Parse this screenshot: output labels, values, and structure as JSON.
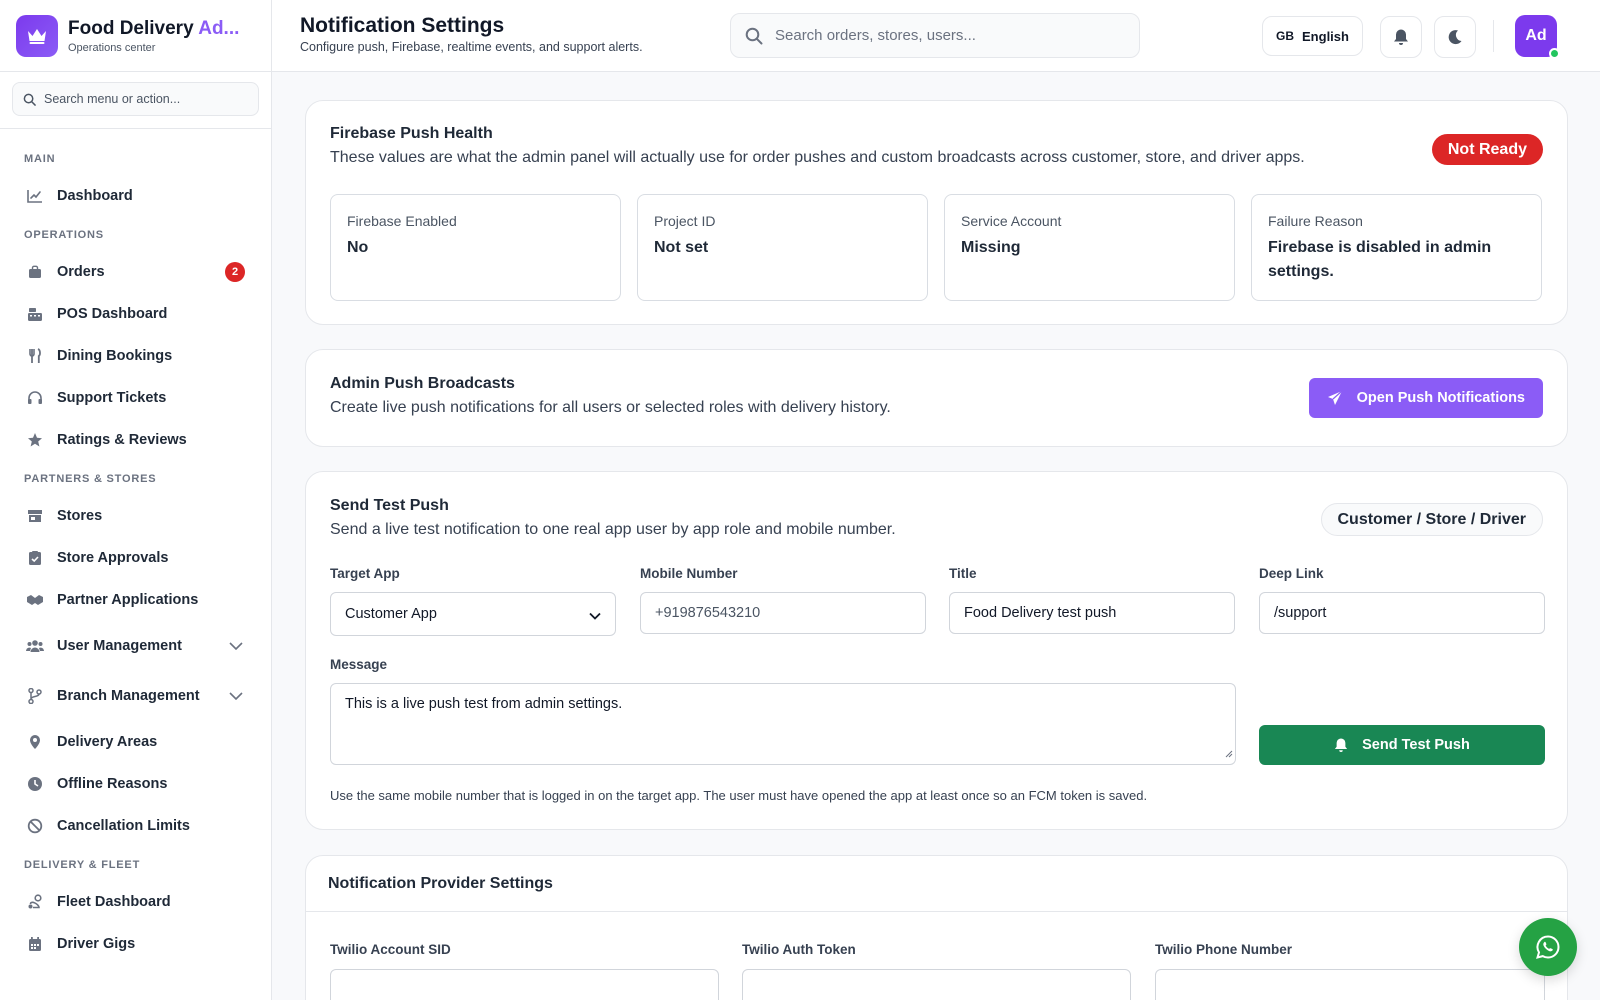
{
  "brand": {
    "title_main": "Food Delivery ",
    "title_accent": "Ad...",
    "subtitle": "Operations center"
  },
  "sidebar": {
    "search_placeholder": "Search menu or action...",
    "sections": {
      "main": "MAIN",
      "operations": "OPERATIONS",
      "partners": "PARTNERS & STORES",
      "fleet": "DELIVERY & FLEET"
    },
    "items": {
      "dashboard": "Dashboard",
      "orders": "Orders",
      "orders_badge": "2",
      "pos": "POS Dashboard",
      "dining": "Dining Bookings",
      "support": "Support Tickets",
      "ratings": "Ratings & Reviews",
      "stores": "Stores",
      "store_approvals": "Store Approvals",
      "partner_apps": "Partner Applications",
      "user_mgmt": "User Management",
      "branch_mgmt": "Branch Management",
      "delivery_areas": "Delivery Areas",
      "offline_reasons": "Offline Reasons",
      "cancellation": "Cancellation Limits",
      "fleet_dashboard": "Fleet Dashboard",
      "driver_gigs": "Driver Gigs"
    }
  },
  "header": {
    "title": "Notification Settings",
    "subtitle": "Configure push, Firebase, realtime events, and support alerts.",
    "search_placeholder": "Search orders, stores, users...",
    "lang_code": "GB",
    "lang_label": "English",
    "avatar": "Ad"
  },
  "firebase": {
    "title": "Firebase Push Health",
    "desc": "These values are what the admin panel will actually use for order pushes and custom broadcasts across customer, store, and driver apps.",
    "status": "Not Ready",
    "status_color": "#dc2626",
    "stats": [
      {
        "label": "Firebase Enabled",
        "value": "No"
      },
      {
        "label": "Project ID",
        "value": "Not set"
      },
      {
        "label": "Service Account",
        "value": "Missing"
      },
      {
        "label": "Failure Reason",
        "value": "Firebase is disabled in admin settings."
      }
    ]
  },
  "broadcasts": {
    "title": "Admin Push Broadcasts",
    "desc": "Create live push notifications for all users or selected roles with delivery history.",
    "button": "Open Push Notifications"
  },
  "test_push": {
    "title": "Send Test Push",
    "desc": "Send a live test notification to one real app user by app role and mobile number.",
    "roles": "Customer / Store / Driver",
    "target_label": "Target App",
    "target_value": "Customer App",
    "mobile_label": "Mobile Number",
    "mobile_placeholder": "+919876543210",
    "title_label": "Title",
    "title_value": "Food Delivery test push",
    "link_label": "Deep Link",
    "link_value": "/support",
    "message_label": "Message",
    "message_value": "This is a live push test from admin settings.",
    "send_button": "Send Test Push",
    "help": "Use the same mobile number that is logged in on the target app. The user must have opened the app at least once so an FCM token is saved."
  },
  "provider": {
    "title": "Notification Provider Settings",
    "sid_label": "Twilio Account SID",
    "token_label": "Twilio Auth Token",
    "phone_label": "Twilio Phone Number"
  },
  "colors": {
    "accent": "#8b5cf6",
    "success": "#198754",
    "danger": "#dc2626",
    "whatsapp": "#25a244"
  }
}
